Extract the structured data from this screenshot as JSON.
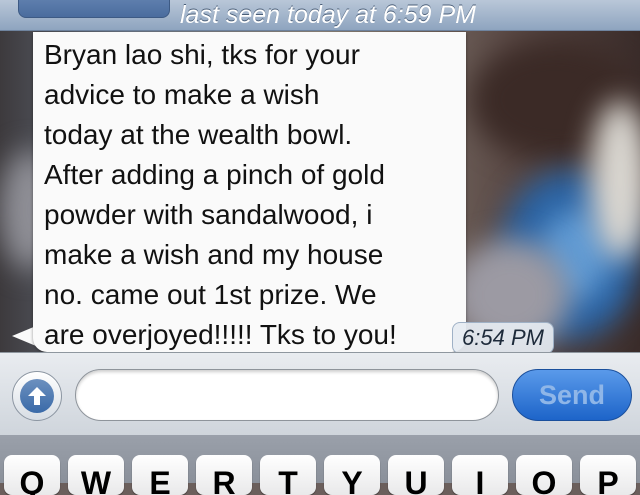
{
  "header": {
    "status": "last seen today at 6:59 PM"
  },
  "message": {
    "lines": [
      "Bryan lao shi, tks for your",
      "advice to make a wish",
      "today at the wealth bowl.",
      "After adding a pinch of gold",
      "powder with sandalwood, i",
      "make a wish and my house",
      "no. came out 1st prize. We",
      "are overjoyed!!!!! Tks to you!"
    ],
    "time": "6:54 PM"
  },
  "input": {
    "camera_icon": "upload-arrow-icon",
    "placeholder": "",
    "send_label": "Send"
  },
  "keyboard": {
    "keys": [
      "Q",
      "W",
      "E",
      "R",
      "T",
      "Y",
      "U",
      "I",
      "O",
      "P"
    ]
  }
}
